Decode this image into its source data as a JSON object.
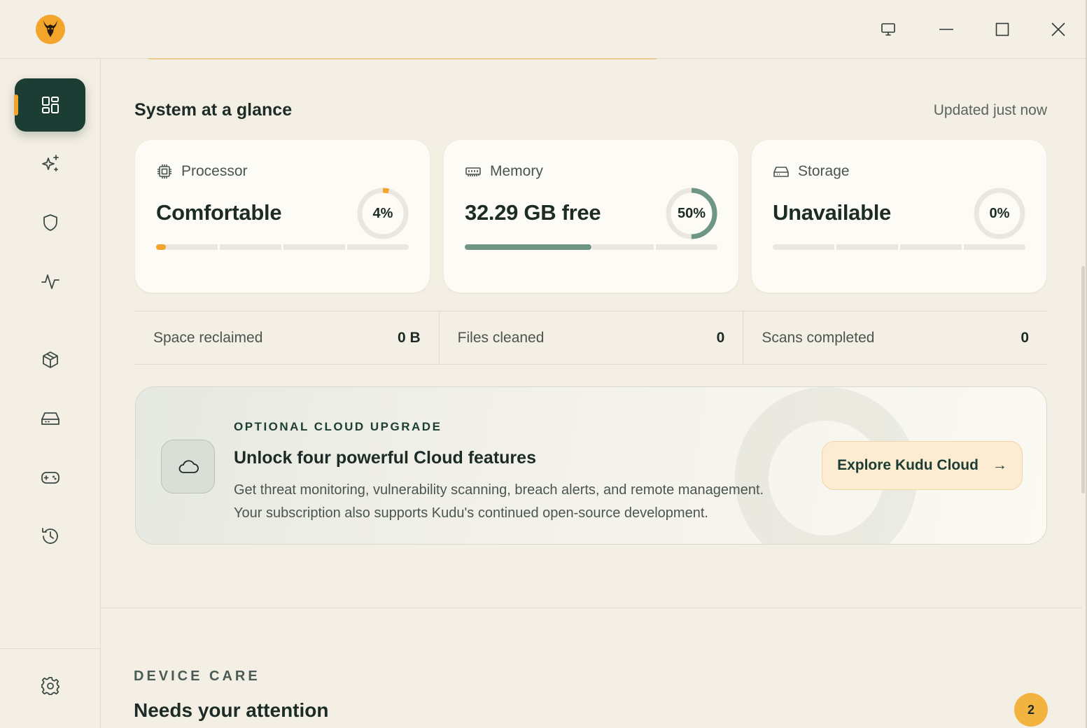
{
  "app": {
    "name": "Kudu",
    "logo_icon": "kudu-logo-icon"
  },
  "window_controls": {
    "icons": [
      "monitor-icon",
      "minimize-icon",
      "maximize-icon",
      "close-icon"
    ]
  },
  "sidebar": {
    "items": [
      {
        "icon": "dashboard-icon",
        "active": true
      },
      {
        "icon": "sparkles-icon",
        "active": false
      },
      {
        "icon": "shield-icon",
        "active": false
      },
      {
        "icon": "activity-icon",
        "active": false
      },
      {
        "icon": "package-icon",
        "active": false
      },
      {
        "icon": "drive-icon",
        "active": false
      },
      {
        "icon": "gamepad-icon",
        "active": false
      },
      {
        "icon": "history-icon",
        "active": false
      }
    ],
    "settings_icon": "gear-icon"
  },
  "overview": {
    "title": "System at a glance",
    "updated": "Updated just now"
  },
  "cards": [
    {
      "label": "Processor",
      "icon": "cpu-icon",
      "value": "Comfortable",
      "percent_label": "4%",
      "percent": 4,
      "accent": "#f2a52a"
    },
    {
      "label": "Memory",
      "icon": "memory-icon",
      "value": "32.29 GB free",
      "percent_label": "50%",
      "percent": 50,
      "accent": "#6f9684"
    },
    {
      "label": "Storage",
      "icon": "hard-drive-icon",
      "value": "Unavailable",
      "percent_label": "0%",
      "percent": 0,
      "accent": "#6f9684"
    }
  ],
  "stats": [
    {
      "label": "Space reclaimed",
      "value": "0 B"
    },
    {
      "label": "Files cleaned",
      "value": "0"
    },
    {
      "label": "Scans completed",
      "value": "0"
    }
  ],
  "promo": {
    "eyebrow": "OPTIONAL CLOUD UPGRADE",
    "title": "Unlock four powerful Cloud features",
    "desc_line1": "Get threat monitoring, vulnerability scanning, breach alerts, and remote management.",
    "desc_line2": "Your subscription also supports Kudu's continued open-source development.",
    "button": "Explore Kudu Cloud",
    "button_arrow": "→",
    "icon": "cloud-icon"
  },
  "device_care": {
    "eyebrow": "DEVICE CARE",
    "title": "Needs your attention",
    "badge": "2"
  },
  "colors": {
    "background": "#f4efe4",
    "primary": "#1c3d33",
    "accent": "#f2a52a",
    "memory": "#6f9684"
  }
}
